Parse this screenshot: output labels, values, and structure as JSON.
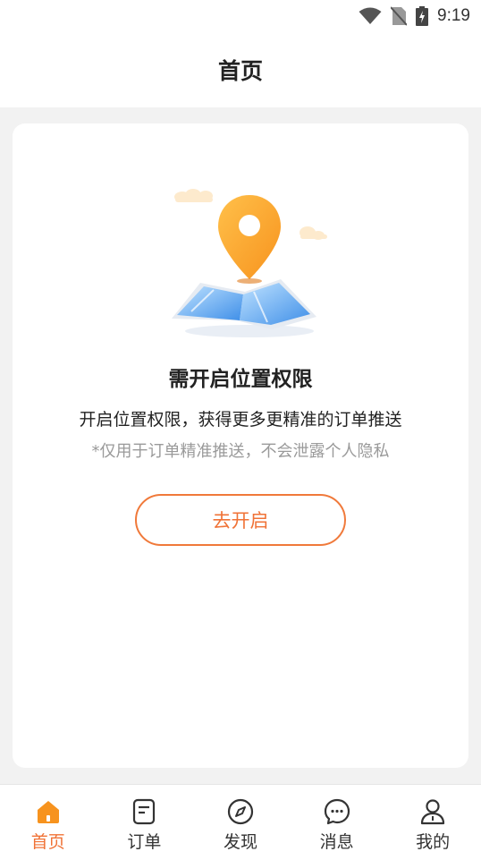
{
  "status_bar": {
    "time": "9:19"
  },
  "header": {
    "title": "首页"
  },
  "permission": {
    "title": "需开启位置权限",
    "description": "开启位置权限，获得更多更精准的订单推送",
    "note": "*仅用于订单精准推送，不会泄露个人隐私",
    "button_label": "去开启"
  },
  "tabs": [
    {
      "label": "首页",
      "icon": "home-icon",
      "active": true
    },
    {
      "label": "订单",
      "icon": "order-icon",
      "active": false
    },
    {
      "label": "发现",
      "icon": "compass-icon",
      "active": false
    },
    {
      "label": "消息",
      "icon": "message-icon",
      "active": false
    },
    {
      "label": "我的",
      "icon": "profile-icon",
      "active": false
    }
  ],
  "colors": {
    "accent": "#f07236",
    "background": "#f2f2f2"
  }
}
